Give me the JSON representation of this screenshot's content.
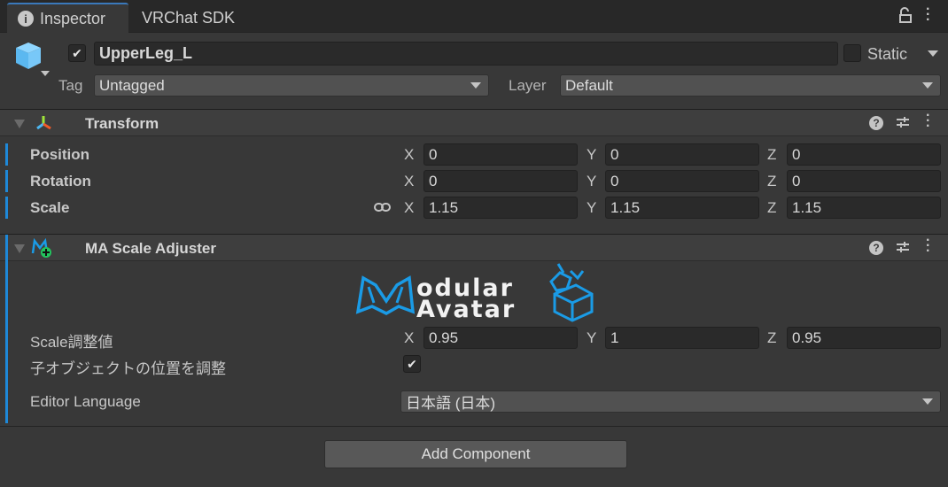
{
  "tabs": [
    {
      "label": "Inspector",
      "icon": "info-icon",
      "active": true
    },
    {
      "label": "VRChat SDK",
      "active": false
    }
  ],
  "object": {
    "active": true,
    "name": "UpperLeg_L",
    "static_label": "Static",
    "static": false,
    "tag_label": "Tag",
    "tag": "Untagged",
    "layer_label": "Layer",
    "layer": "Default"
  },
  "transform": {
    "title": "Transform",
    "rows": [
      {
        "label": "Position",
        "x": "0",
        "y": "0",
        "z": "0"
      },
      {
        "label": "Rotation",
        "x": "0",
        "y": "0",
        "z": "0"
      },
      {
        "label": "Scale",
        "x": "1.15",
        "y": "1.15",
        "z": "1.15"
      }
    ]
  },
  "axes": {
    "x": "X",
    "y": "Y",
    "z": "Z"
  },
  "ma": {
    "title": "MA Scale Adjuster",
    "logo_text": "Modular Avatar",
    "scale_label": "Scale調整値",
    "scale": {
      "x": "0.95",
      "y": "1",
      "z": "0.95"
    },
    "adjust_children_label": "子オブジェクトの位置を調整",
    "adjust_children": true,
    "language_label": "Editor Language",
    "language": "日本語 (日本)"
  },
  "add_component": "Add Component",
  "colors": {
    "accent": "#1e88d8",
    "logo": "#1a9be6"
  }
}
